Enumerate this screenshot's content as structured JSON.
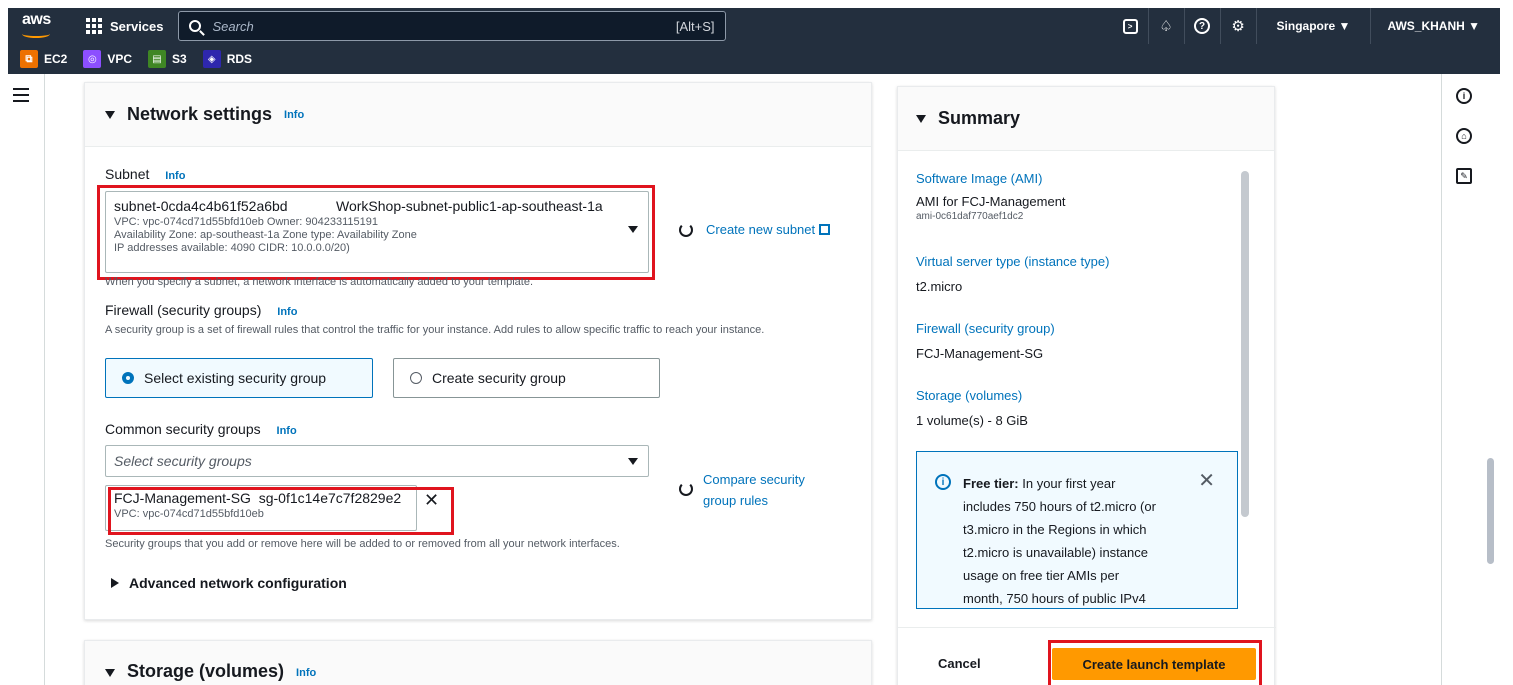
{
  "nav": {
    "logo": "aws",
    "services": "Services",
    "search_placeholder": "Search",
    "search_shortcut": "[Alt+S]",
    "region": "Singapore ▼",
    "account": "AWS_KHANH ▼"
  },
  "favorites": [
    {
      "label": "EC2",
      "color": "#ed7100"
    },
    {
      "label": "VPC",
      "color": "#8c4fff"
    },
    {
      "label": "S3",
      "color": "#3f8624"
    },
    {
      "label": "RDS",
      "color": "#2e27ad"
    }
  ],
  "network": {
    "title": "Network settings",
    "info": "Info",
    "subnet_label": "Subnet",
    "subnet_id": "subnet-0cda4c4b61f52a6bd",
    "subnet_name": "WorkShop-subnet-public1-ap-southeast-1a",
    "subnet_line1": "VPC: vpc-074cd71d55bfd10eb    Owner: 904233115191",
    "subnet_line2": "Availability Zone: ap-southeast-1a    Zone type: Availability Zone",
    "subnet_line3": "IP addresses available: 4090    CIDR: 10.0.0.0/20)",
    "subnet_hint": "When you specify a subnet, a network interface is automatically added to your template.",
    "create_subnet": "Create new subnet",
    "firewall_label": "Firewall (security groups)",
    "firewall_desc": "A security group is a set of firewall rules that control the traffic for your instance. Add rules to allow specific traffic to reach your instance.",
    "opt_existing": "Select existing security group",
    "opt_create": "Create security group",
    "common_label": "Common security groups",
    "select_placeholder": "Select security groups",
    "compare_line1": "Compare security",
    "compare_line2": "group rules",
    "sg_name": "FCJ-Management-SG",
    "sg_id": "sg-0f1c14e7c7f2829e2",
    "sg_vpc": "VPC: vpc-074cd71d55bfd10eb",
    "sg_hint": "Security groups that you add or remove here will be added to or removed from all your network interfaces.",
    "advanced": "Advanced network configuration"
  },
  "storage": {
    "title": "Storage (volumes)",
    "info": "Info"
  },
  "summary": {
    "title": "Summary",
    "ami_label": "Software Image (AMI)",
    "ami_value": "AMI for FCJ-Management",
    "ami_id": "ami-0c61daf770aef1dc2",
    "type_label": "Virtual server type (instance type)",
    "type_value": "t2.micro",
    "fw_label": "Firewall (security group)",
    "fw_value": "FCJ-Management-SG",
    "storage_label": "Storage (volumes)",
    "storage_value": "1 volume(s) - 8 GiB",
    "free_bold": "Free tier:",
    "free_l1": " In your first year",
    "free_l2": "includes 750 hours of t2.micro (or",
    "free_l3": "t3.micro in the Regions in which",
    "free_l4": "t2.micro is unavailable) instance",
    "free_l5": "usage on free tier AMIs per",
    "free_l6": "month, 750 hours of public IPv4",
    "cancel": "Cancel",
    "create": "Create launch template"
  }
}
